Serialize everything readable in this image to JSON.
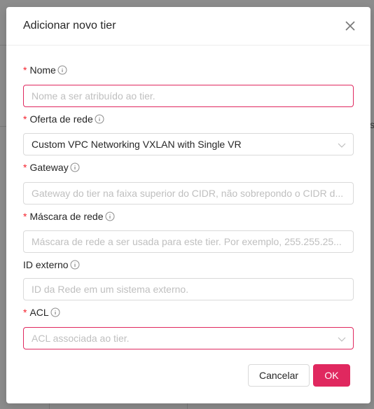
{
  "background": {
    "partial_text": "s"
  },
  "modal": {
    "title": "Adicionar novo tier",
    "fields": [
      {
        "label": "Nome",
        "required": true,
        "type": "input",
        "placeholder": "Nome a ser atribuído ao tier.",
        "value": ""
      },
      {
        "label": "Oferta de rede",
        "required": true,
        "type": "select",
        "value": "Custom VPC Networking VXLAN with Single VR"
      },
      {
        "label": "Gateway",
        "required": true,
        "type": "input",
        "placeholder": "Gateway do tier na faixa superior do CIDR, não sobrepondo o CIDR d...",
        "value": ""
      },
      {
        "label": "Máscara de rede",
        "required": true,
        "type": "input",
        "placeholder": "Máscara de rede a ser usada para este tier. Por exemplo, 255.255.25...",
        "value": ""
      },
      {
        "label": "ID externo",
        "required": false,
        "type": "input",
        "placeholder": "ID da Rede em um sistema externo.",
        "value": ""
      },
      {
        "label": "ACL",
        "required": true,
        "type": "select",
        "placeholder": "ACL associada ao tier.",
        "value": ""
      }
    ],
    "buttons": {
      "cancel": "Cancelar",
      "ok": "OK"
    }
  },
  "colors": {
    "accent": "#e0285f",
    "required": "#f5222d",
    "overlay": "#8c8c8c"
  }
}
